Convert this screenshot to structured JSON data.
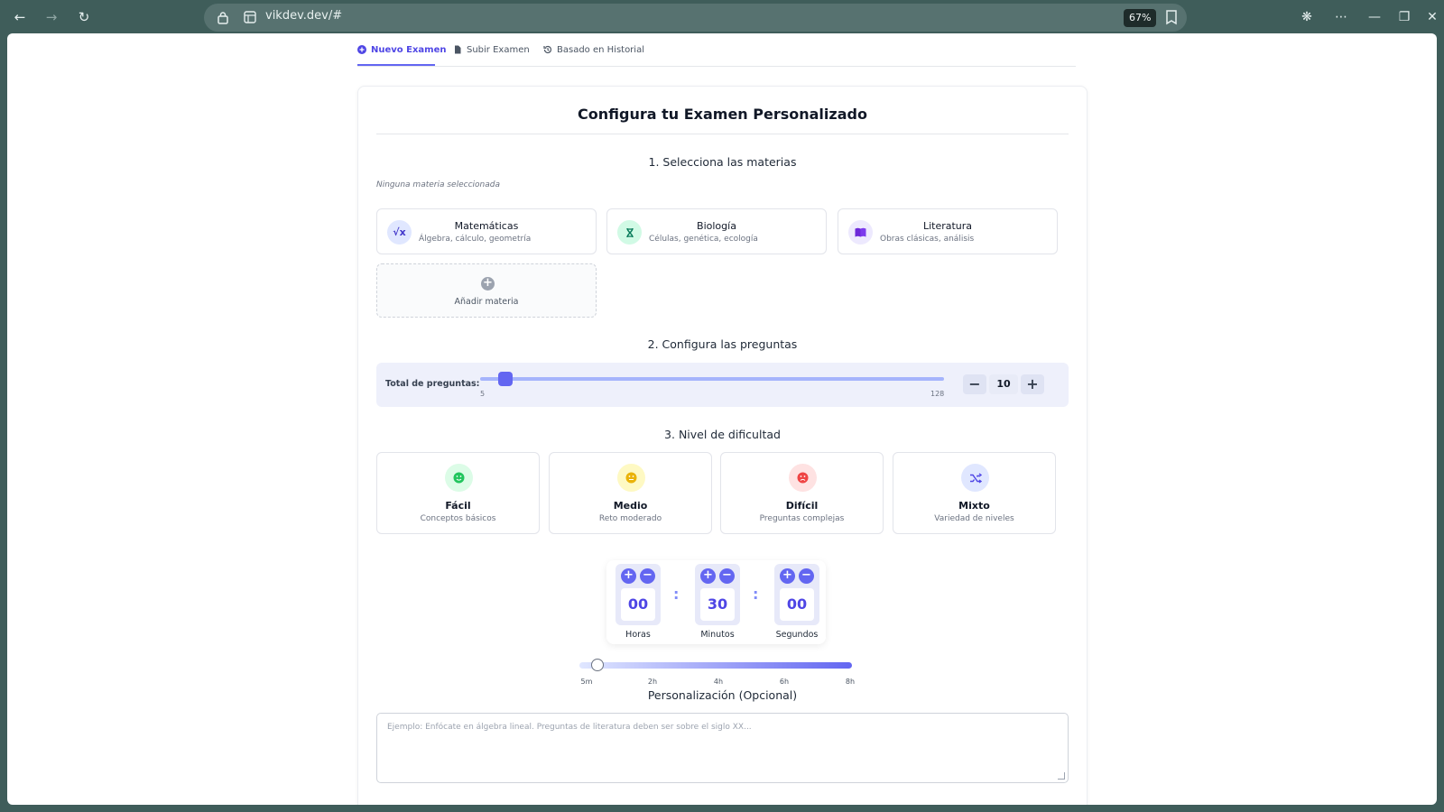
{
  "browser": {
    "url": "vikdev.dev/#",
    "zoom": "67%"
  },
  "tabs": [
    {
      "label": "Nuevo Examen",
      "active": true
    },
    {
      "label": "Subir Examen",
      "active": false
    },
    {
      "label": "Basado en Historial",
      "active": false
    }
  ],
  "form": {
    "title": "Configura tu Examen Personalizado",
    "section_subjects": "1. Selecciona las materias",
    "subjects_hint": "Ninguna materia seleccionada",
    "subjects": [
      {
        "name": "Matemáticas",
        "desc": "Álgebra, cálculo, geometría",
        "icon": "sqrt-icon",
        "color": "#4f46e5"
      },
      {
        "name": "Biología",
        "desc": "Células, genética, ecología",
        "icon": "dna-icon",
        "color": "#059669"
      },
      {
        "name": "Literatura",
        "desc": "Obras clásicas, análisis",
        "icon": "book-icon",
        "color": "#7c3aed"
      }
    ],
    "add_subject": "Añadir materia",
    "section_questions": "2. Configura las preguntas",
    "questions": {
      "label": "Total de preguntas:",
      "min": "5",
      "max": "128",
      "value": "10",
      "value_number": 10,
      "decrement": "−",
      "increment": "+"
    },
    "section_difficulty": "3. Nivel de dificultad",
    "difficulties": [
      {
        "name": "Fácil",
        "desc": "Conceptos básicos",
        "icon": "smile-icon",
        "color": "#16a34a"
      },
      {
        "name": "Medio",
        "desc": "Reto moderado",
        "icon": "neutral-face-icon",
        "color": "#ca8a04"
      },
      {
        "name": "Difícil",
        "desc": "Preguntas complejas",
        "icon": "sad-face-icon",
        "color": "#dc2626"
      },
      {
        "name": "Mixto",
        "desc": "Variedad de niveles",
        "icon": "shuffle-icon",
        "color": "#4f46e5"
      }
    ],
    "timer": {
      "hours": {
        "value": "00",
        "label": "Horas"
      },
      "minutes": {
        "value": "30",
        "label": "Minutos"
      },
      "seconds": {
        "value": "00",
        "label": "Segundos"
      },
      "plus": "+",
      "minus": "−",
      "separator": ":"
    },
    "duration": {
      "ticks": [
        "5m",
        "2h",
        "4h",
        "6h",
        "8h"
      ],
      "value_minutes": 30,
      "min_minutes": 5,
      "max_minutes": 480
    },
    "section_custom": "Personalización (Opcional)",
    "custom_placeholder": "Ejemplo: Enfócate en álgebra lineal. Preguntas de literatura deben ser sobre el siglo XX..."
  }
}
